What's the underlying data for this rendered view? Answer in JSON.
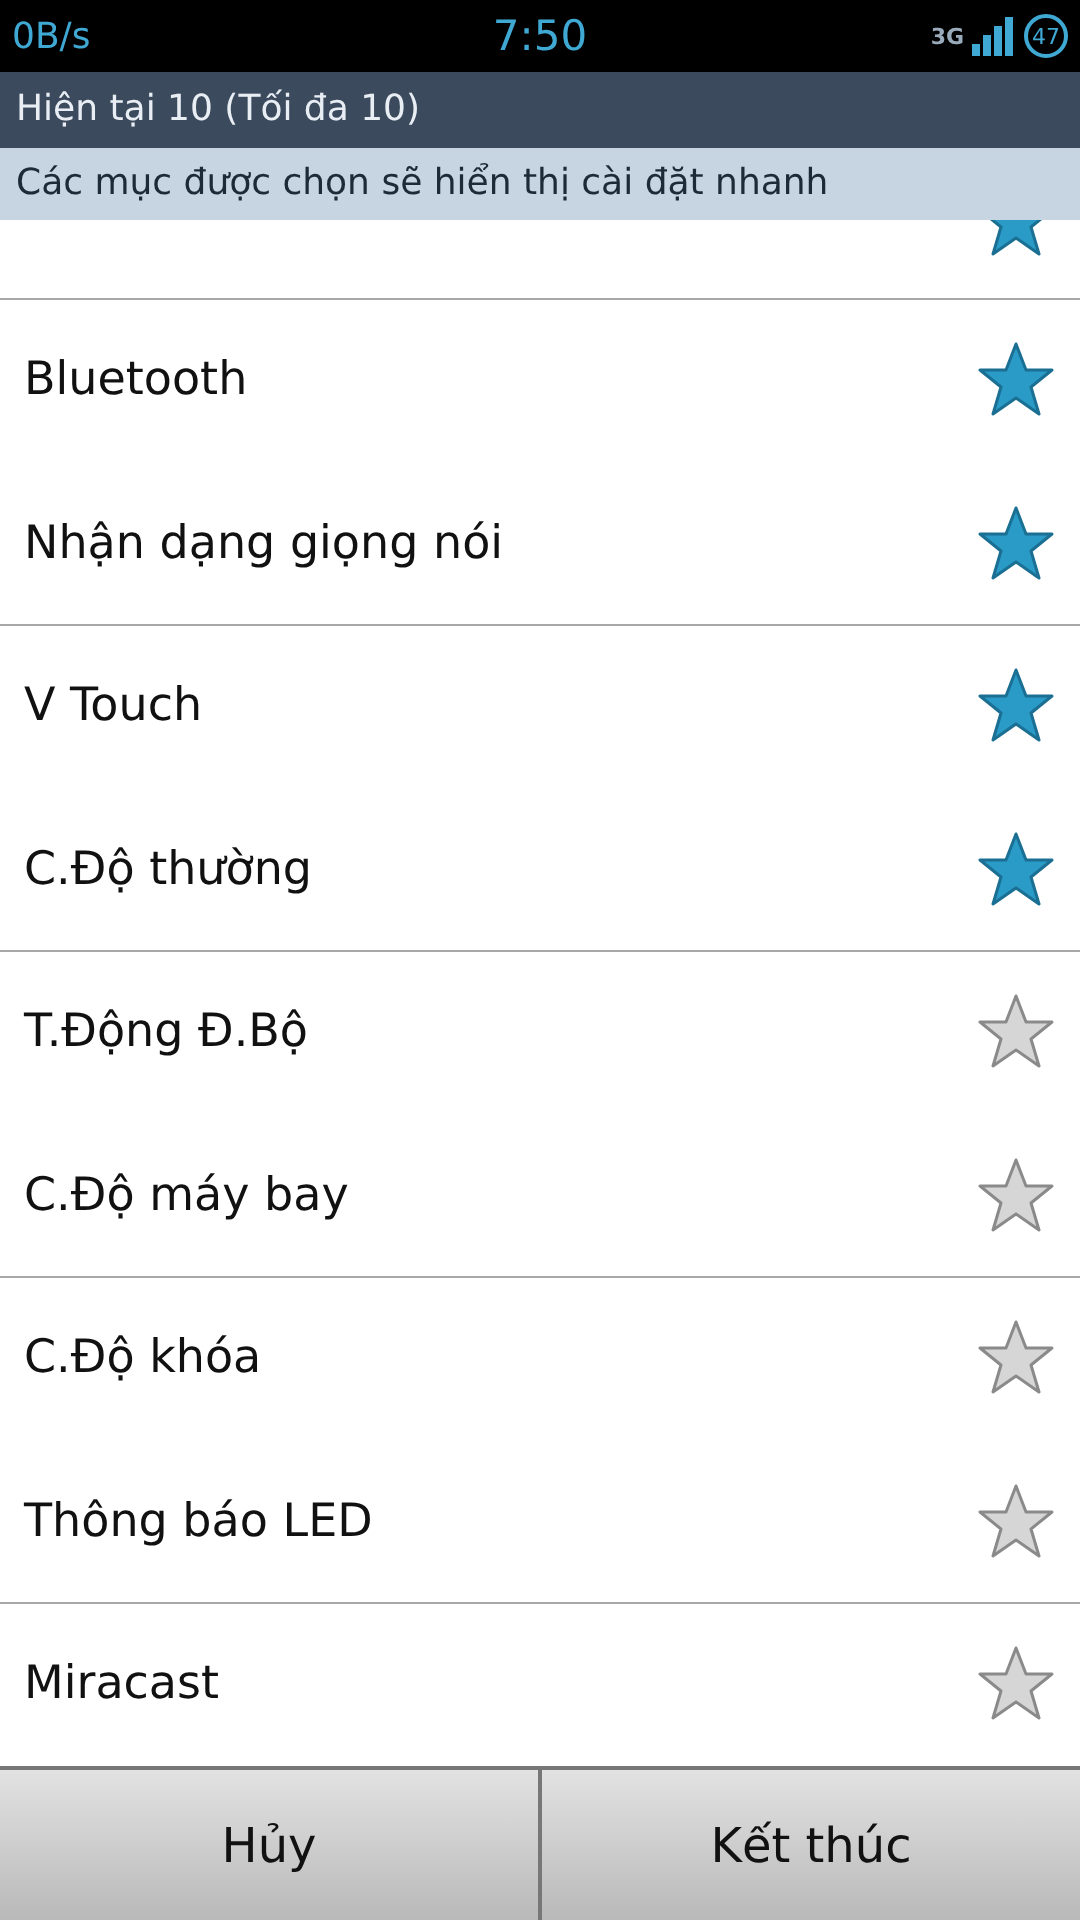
{
  "status_bar": {
    "speed": "0B/s",
    "time": "7:50",
    "network": "3G",
    "battery": "47"
  },
  "title": "Hiện tại 10 (Tối đa 10)",
  "subtitle": "Các mục được chọn sẽ hiển thị cài đặt nhanh",
  "partial_item": {
    "checked": true
  },
  "items": [
    {
      "label": "Bluetooth",
      "checked": true
    },
    {
      "label": "Nhận dạng giọng nói",
      "checked": true
    },
    {
      "label": "V Touch",
      "checked": true
    },
    {
      "label": "C.Độ thường",
      "checked": true
    },
    {
      "label": "T.Động Đ.Bộ",
      "checked": false
    },
    {
      "label": "C.Độ máy bay",
      "checked": false
    },
    {
      "label": "C.Độ khóa",
      "checked": false
    },
    {
      "label": "Thông báo LED",
      "checked": false
    },
    {
      "label": "Miracast",
      "checked": false
    }
  ],
  "buttons": [
    "Hủy",
    "Kết thúc"
  ]
}
